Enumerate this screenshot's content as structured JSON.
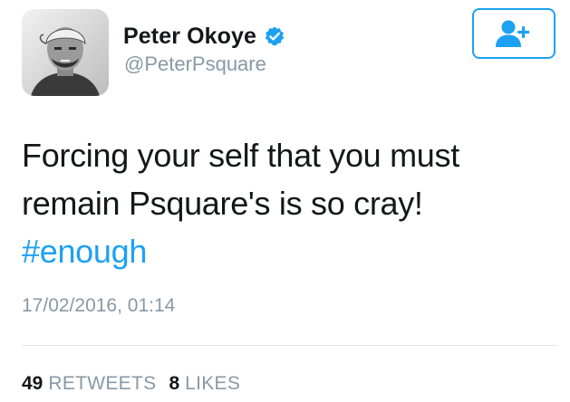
{
  "author": {
    "display_name": "Peter Okoye",
    "handle": "@PeterPsquare",
    "verified": true,
    "avatar_icon": "profile-photo"
  },
  "follow_button": {
    "icon": "add-user-icon"
  },
  "tweet": {
    "lines": [
      "Forcing your self that you must",
      "remain Psquare's is so cray!"
    ],
    "hashtag": "#enough",
    "timestamp": "17/02/2016, 01:14"
  },
  "stats": {
    "retweets_count": "49",
    "retweets_label": "RETWEETS",
    "likes_count": "8",
    "likes_label": "LIKES"
  },
  "colors": {
    "accent": "#1da1f2",
    "text": "#14171a",
    "muted": "#8899a6",
    "divider": "#e1e8ed"
  }
}
